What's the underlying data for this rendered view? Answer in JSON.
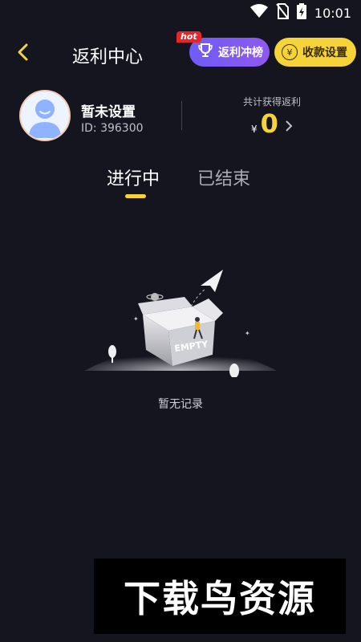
{
  "status_bar": {
    "time": "10:01",
    "icons": [
      "wifi-icon",
      "no-sim-icon",
      "battery-charging-icon"
    ]
  },
  "header": {
    "title": "返利中心",
    "rank_button": {
      "label": "返利冲榜",
      "badge": "hot",
      "icon": "trophy-icon"
    },
    "payout_button": {
      "label": "收款设置",
      "icon": "yen-coin-icon",
      "icon_glyph": "¥"
    }
  },
  "profile": {
    "name": "暂未设置",
    "id": "ID: 396300",
    "total_label": "共计获得返利",
    "currency": "¥",
    "amount": "0"
  },
  "tabs": [
    {
      "label": "进行中",
      "active": true
    },
    {
      "label": "已结束",
      "active": false
    }
  ],
  "empty_state": {
    "box_label": "EMPTY",
    "message": "暂无记录"
  },
  "watermark": {
    "text": "下载鸟资源"
  },
  "colors": {
    "background": "#15151f",
    "accent_yellow": "#f7d33a",
    "rank_gradient_start": "#6f5cf6",
    "rank_gradient_end": "#8e58ef",
    "hot_red": "#e3272b"
  }
}
